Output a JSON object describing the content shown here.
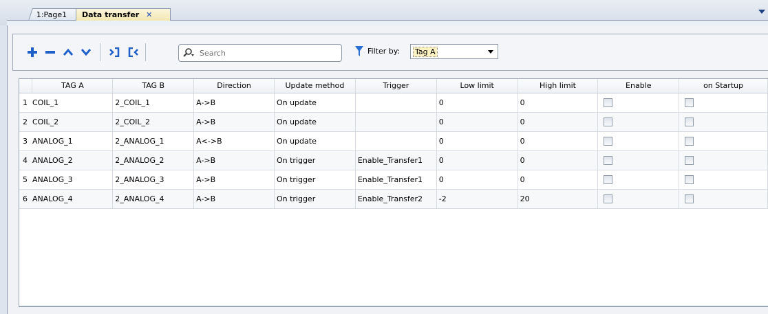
{
  "tabs": [
    {
      "label": "1:Page1",
      "active": false
    },
    {
      "label": "Data transfer",
      "active": true,
      "closable": true
    }
  ],
  "toolbar": {
    "buttons": [
      {
        "name": "add-icon"
      },
      {
        "name": "remove-icon"
      },
      {
        "name": "move-up-icon"
      },
      {
        "name": "move-down-icon"
      },
      {
        "name": "export-icon"
      },
      {
        "name": "import-icon"
      }
    ],
    "search_placeholder": "Search",
    "filter_label": "Filter by:",
    "filter_value": "Tag A"
  },
  "grid": {
    "columns": [
      "TAG A",
      "TAG B",
      "Direction",
      "Update method",
      "Trigger",
      "Low limit",
      "High limit",
      "Enable",
      "on Startup"
    ],
    "rows": [
      {
        "num": "1",
        "tag_a": "COIL_1",
        "tag_b": "2_COIL_1",
        "direction": "A->B",
        "update": "On update",
        "trigger": "",
        "low": "0",
        "high": "0",
        "enable": false,
        "startup": false
      },
      {
        "num": "2",
        "tag_a": "COIL_2",
        "tag_b": "2_COIL_2",
        "direction": "A->B",
        "update": "On update",
        "trigger": "",
        "low": "0",
        "high": "0",
        "enable": false,
        "startup": false
      },
      {
        "num": "3",
        "tag_a": "ANALOG_1",
        "tag_b": "2_ANALOG_1",
        "direction": "A<->B",
        "update": "On update",
        "trigger": "",
        "low": "0",
        "high": "0",
        "enable": false,
        "startup": false
      },
      {
        "num": "4",
        "tag_a": "ANALOG_2",
        "tag_b": "2_ANALOG_2",
        "direction": "A->B",
        "update": "On trigger",
        "trigger": "Enable_Transfer1",
        "low": "0",
        "high": "0",
        "enable": false,
        "startup": false
      },
      {
        "num": "5",
        "tag_a": "ANALOG_3",
        "tag_b": "2_ANALOG_3",
        "direction": "A->B",
        "update": "On trigger",
        "trigger": "Enable_Transfer1",
        "low": "0",
        "high": "0",
        "enable": false,
        "startup": false
      },
      {
        "num": "6",
        "tag_a": "ANALOG_4",
        "tag_b": "2_ANALOG_4",
        "direction": "A->B",
        "update": "On trigger",
        "trigger": "Enable_Transfer2",
        "low": "-2",
        "high": "20",
        "enable": false,
        "startup": false
      }
    ]
  },
  "colors": {
    "accent": "#1f5fc9",
    "active_tab": "#f3e7b0",
    "filter_icon": "#2a6fd6"
  }
}
